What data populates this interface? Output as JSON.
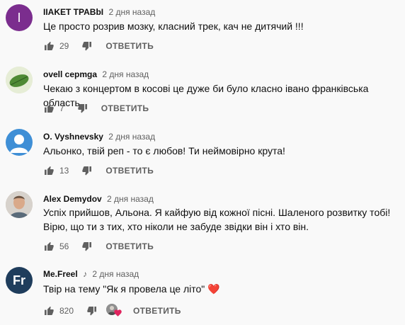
{
  "comments": [
    {
      "author": "IIAKET TPABbI",
      "time": "2 дня назад",
      "avatar_letter": "I",
      "avatar_color": "#7b2d8e",
      "text": "Це просто розрив мозку, класний трек, кач не дитячий !!!",
      "likes": "29",
      "reply_label": "ОТВЕТИТЬ"
    },
    {
      "author": "ovell cepmga",
      "time": "2 дня назад",
      "avatar_color": "#5a8a3a",
      "text": "Чекаю з концертом в косові це дуже би було класно івано франківська область",
      "likes": "7",
      "reply_label": "ОТВЕТИТЬ"
    },
    {
      "author": "O. Vyshnevsky",
      "time": "2 дня назад",
      "avatar_color": "#3f8fd6",
      "text": "Альонко, твій реп - то є любов! Ти неймовірно крута!",
      "likes": "13",
      "reply_label": "ОТВЕТИТЬ"
    },
    {
      "author": "Alex Demydov",
      "time": "2 дня назад",
      "avatar_color": "#b9a08a",
      "text": "Успіх прийшов, Альона. Я кайфую від кожної пісні. Шаленого розвитку тобі! Вірю, що ти з тих, хто ніколи не забуде звідки він і хто він.",
      "likes": "56",
      "reply_label": "ОТВЕТИТЬ"
    },
    {
      "author": "Me.Freel",
      "time": "2 дня назад",
      "avatar_letters": "Fr",
      "avatar_color": "#1f3d5c",
      "text": "Твір на тему \"Як я провела це літо\" ❤️",
      "likes": "820",
      "reply_label": "ОТВЕТИТЬ"
    }
  ],
  "colors": {
    "text": "#0f0f0f",
    "secondary": "#606060",
    "heart": "#e0245e"
  }
}
